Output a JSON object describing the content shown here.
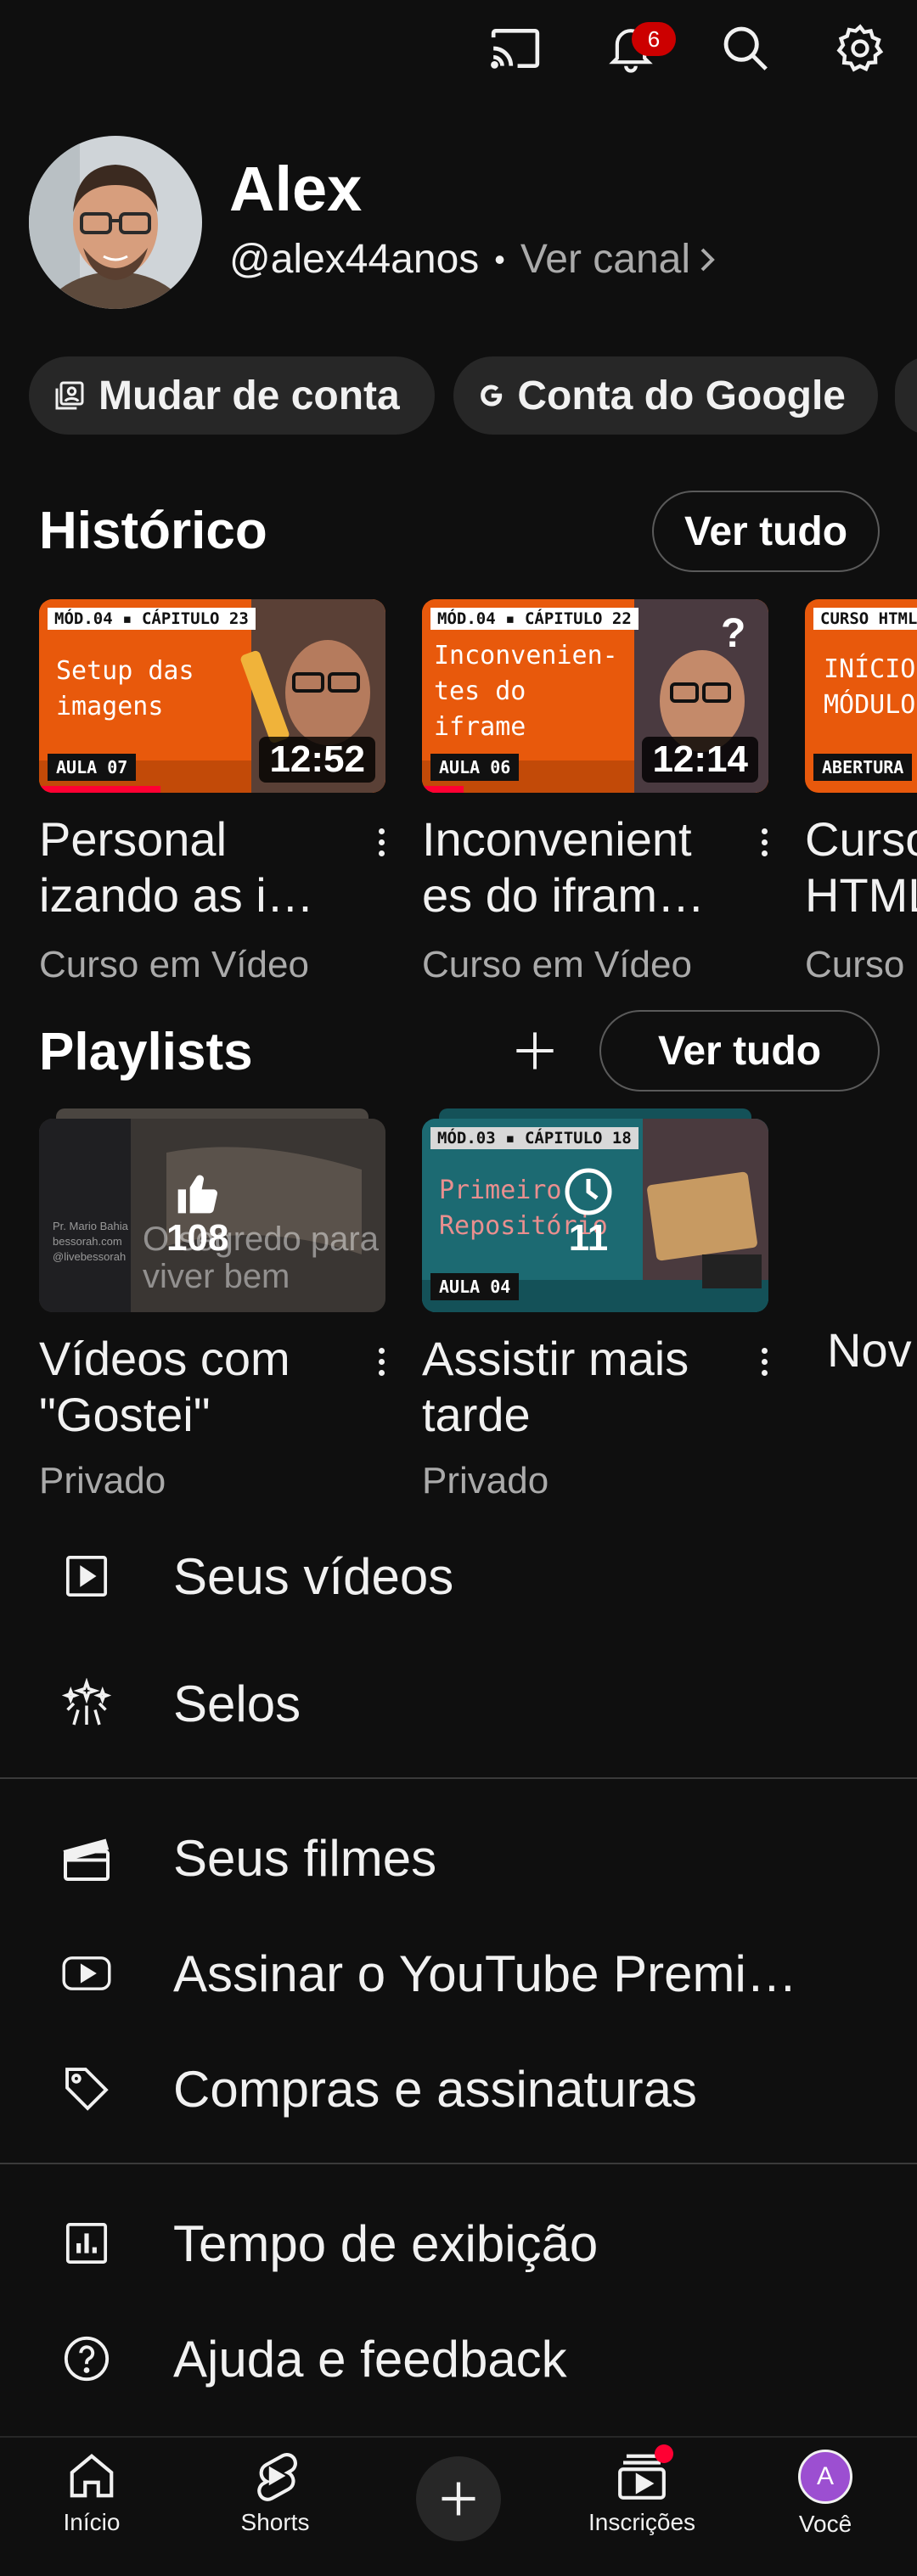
{
  "topbar": {
    "notification_count": "6"
  },
  "profile": {
    "name": "Alex",
    "handle": "@alex44anos",
    "separator": "•",
    "view_channel": "Ver canal"
  },
  "chips": {
    "switch_account": "Mudar de conta",
    "google_account": "Conta do Google"
  },
  "history": {
    "title": "Histórico",
    "see_all": "Ver tudo",
    "videos": [
      {
        "tag": "MÓD.04 ▪ CÁPITULO 23",
        "thumb_text_1": "Setup das",
        "thumb_text_2": "imagens",
        "lesson": "AULA 07",
        "duration": "12:52",
        "title_1": "Personal",
        "title_2": "izando as i…",
        "channel": "Curso em Vídeo",
        "progress": 0.35
      },
      {
        "tag": "MÓD.04 ▪ CÁPITULO 22",
        "thumb_text_1": "Inconvenien-",
        "thumb_text_2": "tes do",
        "thumb_text_3": "iframe",
        "lesson": "AULA 06",
        "duration": "12:14",
        "title_1": "Inconvenient",
        "title_2": "es do ifram…",
        "channel": "Curso em Vídeo",
        "progress": 0.12
      },
      {
        "tag": "CURSO HTML",
        "thumb_text_1": "INÍCIO",
        "thumb_text_2": "MÓDULO",
        "lesson": "ABERTURA",
        "title_1": "Curso",
        "title_2": "HTML",
        "channel": "Curso"
      }
    ]
  },
  "playlists": {
    "title": "Playlists",
    "see_all": "Ver tudo",
    "items": [
      {
        "count": "108",
        "overlay_text_1": "O segredo para",
        "overlay_text_2": "viver bem",
        "side_text_1": "Pr. Mario Bahia",
        "side_text_2": "bessorah.com",
        "side_text_3": "@livebessorah",
        "title_1": "Vídeos com",
        "title_2": "\"Gostei\"",
        "privacy": "Privado"
      },
      {
        "count": "11",
        "tag": "MÓD.03 ▪ CÁPITULO 18",
        "thumb_text_1": "Primeiro",
        "thumb_text_2": "Repositório",
        "lesson": "AULA 04",
        "title_1": "Assistir mais",
        "title_2": "tarde",
        "privacy": "Privado"
      },
      {
        "title_1": "Nov"
      }
    ]
  },
  "menu": {
    "your_videos": "Seus vídeos",
    "badges": "Selos",
    "your_movies": "Seus filmes",
    "premium": "Assinar o YouTube Premi…",
    "purchases": "Compras e assinaturas",
    "watch_time": "Tempo de exibição",
    "help": "Ajuda e feedback"
  },
  "bottom_nav": {
    "home": "Início",
    "shorts": "Shorts",
    "subscriptions": "Inscrições",
    "you": "Você",
    "you_initial": "A"
  },
  "colors": {
    "background": "#0f0f0f",
    "chip": "#272727",
    "accent_red": "#ff0033",
    "thumb_orange": "#e8590c",
    "thumb_teal": "#1c6a72",
    "avatar_purple": "#9c4fd1"
  }
}
